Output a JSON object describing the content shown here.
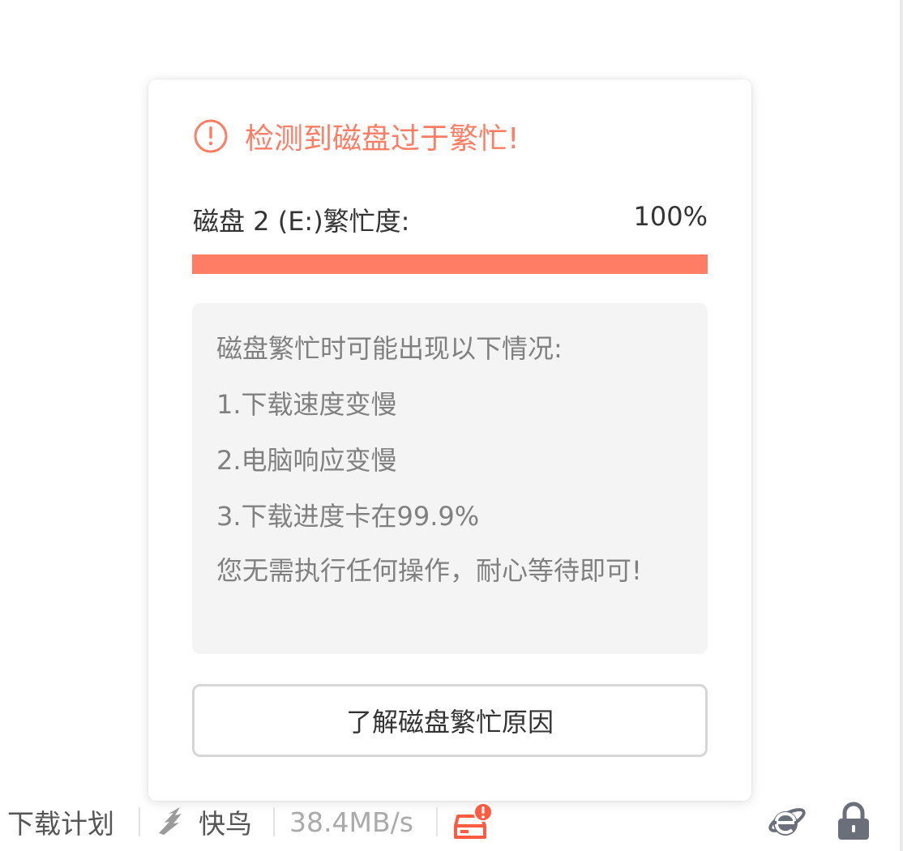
{
  "popup": {
    "title": "检测到磁盘过于繁忙!",
    "busy_label": "磁盘 2 (E:)繁忙度:",
    "busy_value": "100%",
    "busy_fraction": 1.0,
    "info_heading": "磁盘繁忙时可能出现以下情况:",
    "info_items": [
      "1.下载速度变慢",
      "2.电脑响应变慢",
      "3.下载进度卡在99.9%"
    ],
    "info_note": "您无需执行任何操作，耐心等待即可!",
    "learn_button": "了解磁盘繁忙原因"
  },
  "statusbar": {
    "plan_label": "下载计划",
    "kuainiao_label": "快鸟",
    "speed": "38.4MB/s",
    "icons": [
      "kuainiao-bird-icon",
      "disk-busy-icon",
      "ie-browser-icon",
      "lock-icon"
    ]
  },
  "colors": {
    "accent": "#ff7d64",
    "alert": "#ff5a42",
    "icon_gray": "#6b6f7a"
  }
}
